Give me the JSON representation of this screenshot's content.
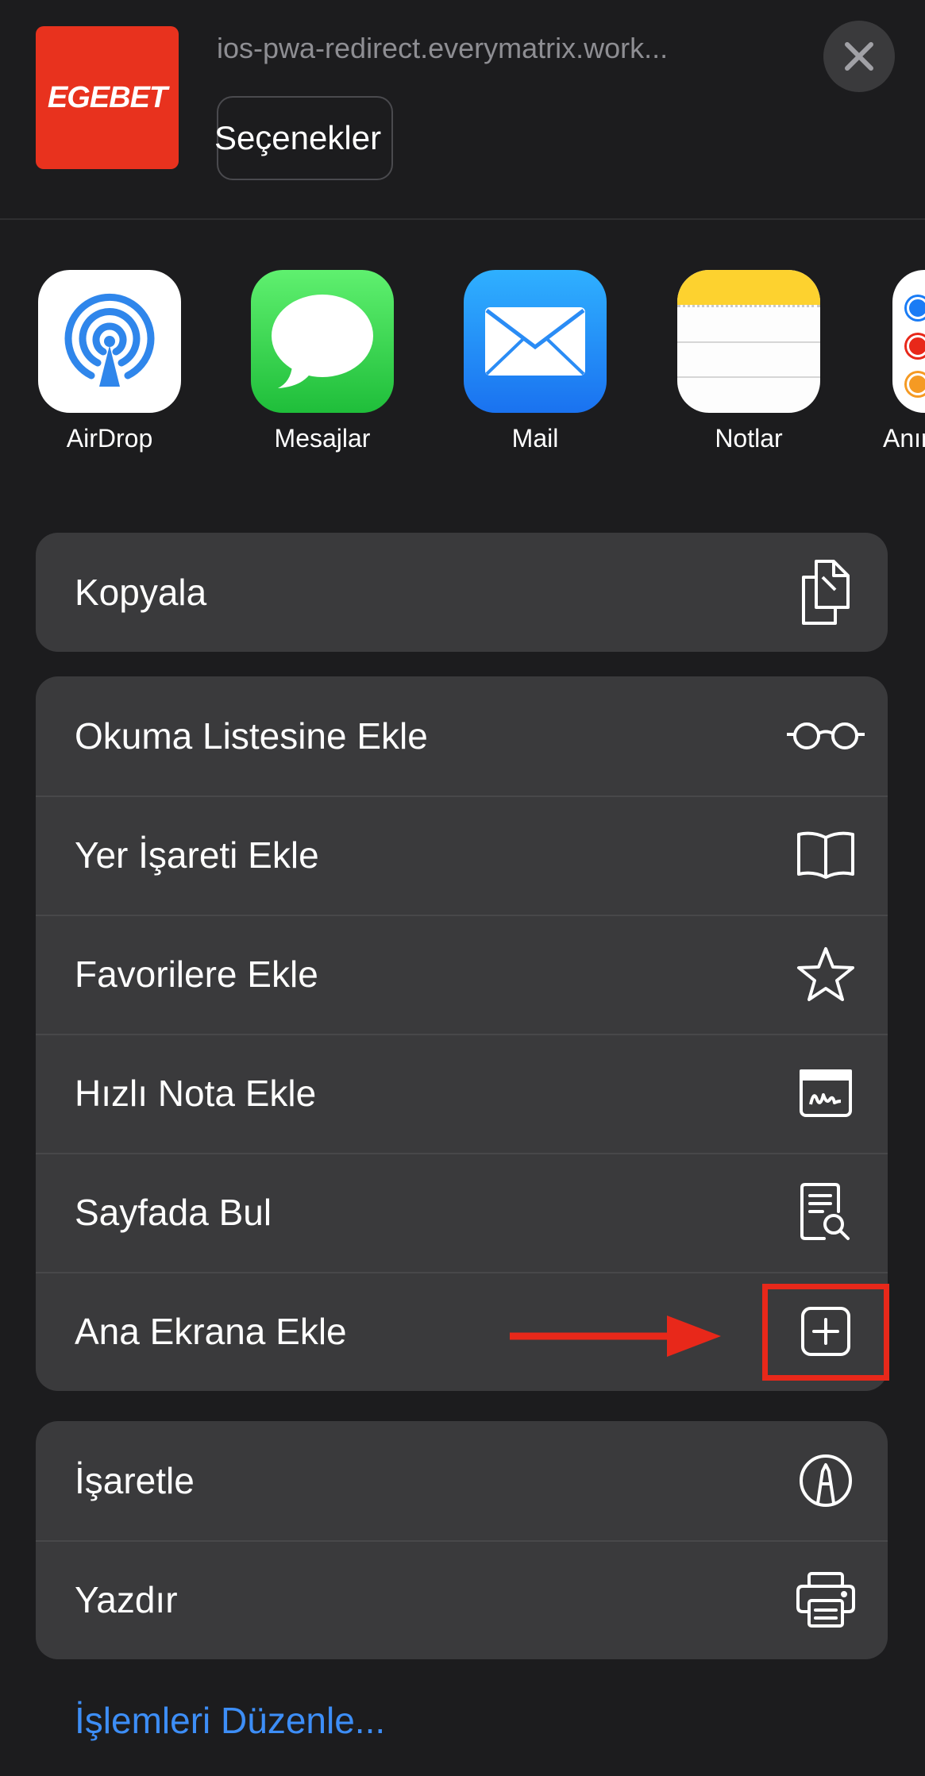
{
  "header": {
    "app_logo_text": "EGEBET",
    "url": "ios-pwa-redirect.everymatrix.work...",
    "options_label": "Seçenekler"
  },
  "share_targets": [
    {
      "label": "AirDrop",
      "icon": "airdrop-icon"
    },
    {
      "label": "Mesajlar",
      "icon": "messages-icon"
    },
    {
      "label": "Mail",
      "icon": "mail-icon"
    },
    {
      "label": "Notlar",
      "icon": "notes-icon"
    },
    {
      "label": "Anım",
      "icon": "reminders-icon"
    }
  ],
  "group1": [
    {
      "label": "Kopyala",
      "icon": "copy-icon"
    }
  ],
  "group2": [
    {
      "label": "Okuma Listesine Ekle",
      "icon": "glasses-icon"
    },
    {
      "label": "Yer İşareti Ekle",
      "icon": "book-icon"
    },
    {
      "label": "Favorilere Ekle",
      "icon": "star-icon"
    },
    {
      "label": "Hızlı Nota Ekle",
      "icon": "quick-note-icon"
    },
    {
      "label": "Sayfada Bul",
      "icon": "find-in-page-icon"
    },
    {
      "label": "Ana Ekrana Ekle",
      "icon": "add-square-icon"
    }
  ],
  "group3": [
    {
      "label": "İşaretle",
      "icon": "markup-icon"
    },
    {
      "label": "Yazdır",
      "icon": "printer-icon"
    }
  ],
  "footer": {
    "edit_actions_label": "İşlemleri Düzenle..."
  },
  "colors": {
    "background": "#1c1c1e",
    "group_bg": "#3a3a3c",
    "link": "#3d8ef7",
    "annotation": "#e8281a",
    "brand": "#e8321e"
  }
}
